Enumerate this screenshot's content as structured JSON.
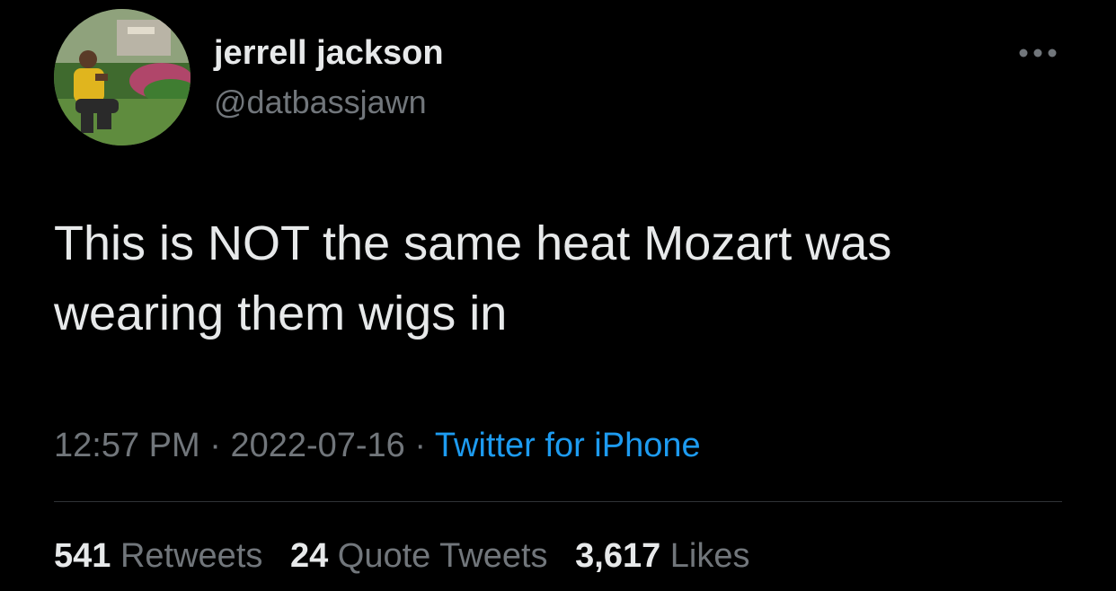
{
  "author": {
    "display_name": "jerrell jackson",
    "handle": "@datbassjawn"
  },
  "tweet": {
    "text_line_1": "This is NOT the same heat Mozart was",
    "text_line_2": "wearing them wigs in"
  },
  "meta": {
    "time": "12:57 PM",
    "separator": " · ",
    "date": "2022-07-16",
    "source": "Twitter for iPhone"
  },
  "stats": {
    "retweets_count": "541",
    "retweets_label": "Retweets",
    "quotes_count": "24",
    "quotes_label": "Quote Tweets",
    "likes_count": "3,617",
    "likes_label": "Likes"
  },
  "icons": {
    "more": "more-horizontal-icon"
  },
  "colors": {
    "background": "#000000",
    "primary_text": "#e7e9ea",
    "secondary_text": "#71767b",
    "accent": "#1d9bf0",
    "divider": "#2f3336"
  }
}
